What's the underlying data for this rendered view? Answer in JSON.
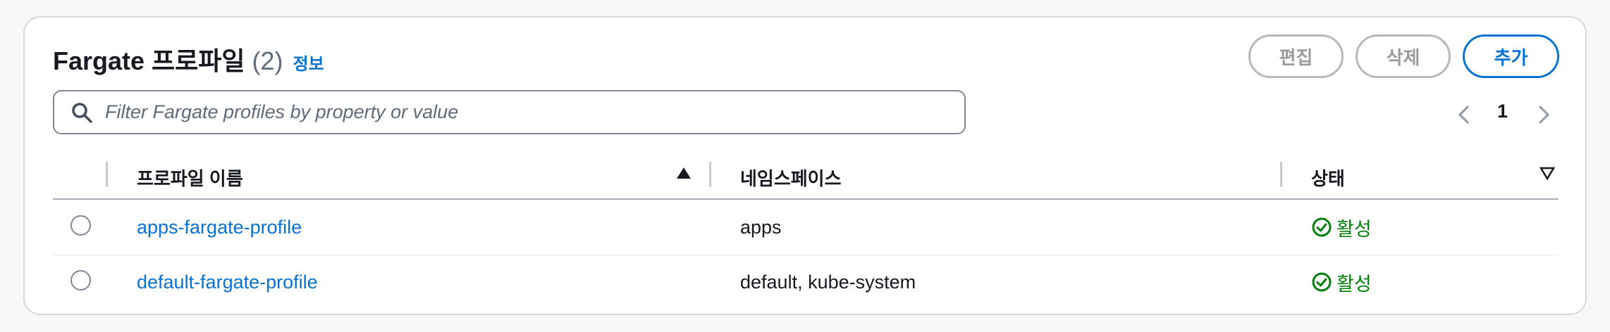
{
  "header": {
    "title": "Fargate 프로파일",
    "count": "(2)",
    "info": "정보"
  },
  "actions": {
    "edit": "편집",
    "delete": "삭제",
    "add": "추가"
  },
  "search": {
    "placeholder": "Filter Fargate profiles by property or value"
  },
  "pagination": {
    "current_page": "1"
  },
  "table": {
    "columns": [
      "프로파일 이름",
      "네임스페이스",
      "상태"
    ],
    "rows": [
      {
        "name": "apps-fargate-profile",
        "namespaces": "apps",
        "status": "활성"
      },
      {
        "name": "default-fargate-profile",
        "namespaces": "default, kube-system",
        "status": "활성"
      }
    ]
  },
  "colors": {
    "link": "#0972d3",
    "success": "#037f0c",
    "disabled": "#9b9b9b"
  }
}
